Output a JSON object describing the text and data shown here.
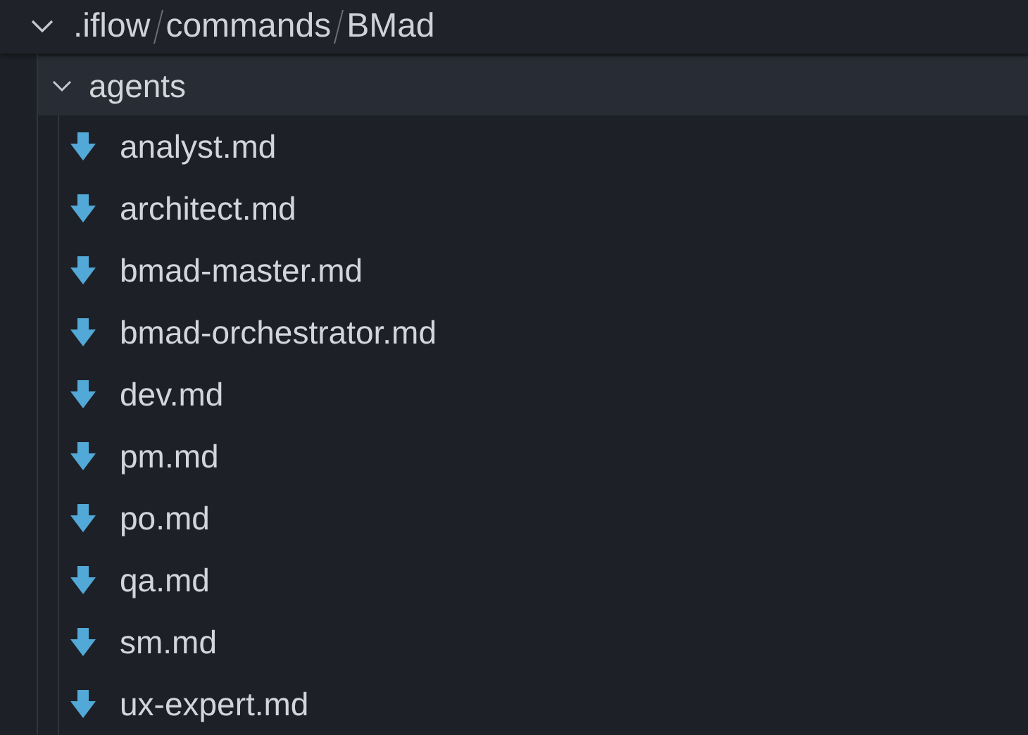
{
  "header": {
    "expanded": true,
    "path_segments": [
      ".iflow",
      "commands",
      "BMad"
    ]
  },
  "tree": [
    {
      "label": "agents",
      "expanded": true,
      "selected": true,
      "children": [
        {
          "label": "analyst.md",
          "selected": false
        },
        {
          "label": "architect.md",
          "selected": false
        },
        {
          "label": "bmad-master.md",
          "selected": false
        },
        {
          "label": "bmad-orchestrator.md",
          "selected": false
        },
        {
          "label": "dev.md",
          "selected": false
        },
        {
          "label": "pm.md",
          "selected": false
        },
        {
          "label": "po.md",
          "selected": false
        },
        {
          "label": "qa.md",
          "selected": false
        },
        {
          "label": "sm.md",
          "selected": false
        },
        {
          "label": "ux-expert.md",
          "selected": false
        }
      ]
    }
  ]
}
